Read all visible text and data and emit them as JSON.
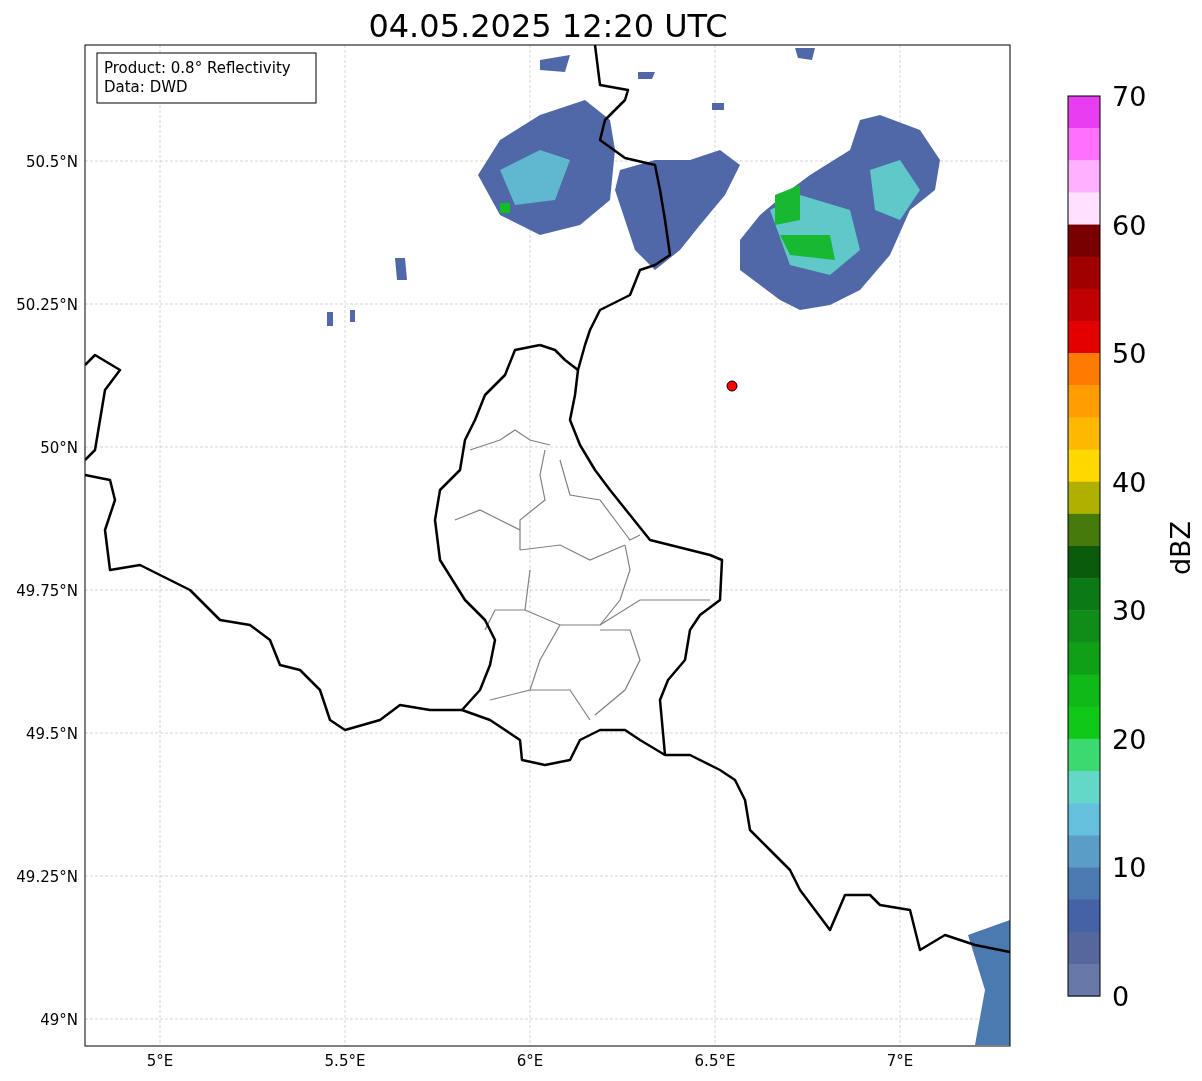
{
  "title": "04.05.2025 12:20 UTC",
  "legend": [
    "Product: 0.8° Reflectivity",
    "Data: DWD"
  ],
  "map": {
    "xticks": [
      "5°E",
      "5.5°E",
      "6°E",
      "6.5°E",
      "7°E"
    ],
    "yticks": [
      "50.5°N",
      "50.25°N",
      "50°N",
      "49.75°N",
      "49.5°N",
      "49.25°N",
      "49°N"
    ]
  },
  "colorbar": {
    "label": "dBZ",
    "ticks": [
      "70",
      "60",
      "50",
      "40",
      "30",
      "20",
      "10",
      "0"
    ],
    "segments": [
      {
        "color": "#e83cf0"
      },
      {
        "color": "#ff70ff"
      },
      {
        "color": "#ffb0ff"
      },
      {
        "color": "#ffe0ff"
      },
      {
        "color": "#780000"
      },
      {
        "color": "#a00000"
      },
      {
        "color": "#c00000"
      },
      {
        "color": "#e40000"
      },
      {
        "color": "#ff7a00"
      },
      {
        "color": "#ff9c00"
      },
      {
        "color": "#ffb800"
      },
      {
        "color": "#ffd800"
      },
      {
        "color": "#b0b000"
      },
      {
        "color": "#467a0c"
      },
      {
        "color": "#0a5c0c"
      },
      {
        "color": "#0c7a14"
      },
      {
        "color": "#108c18"
      },
      {
        "color": "#10a018"
      },
      {
        "color": "#10b818"
      },
      {
        "color": "#10c818"
      },
      {
        "color": "#3cd870"
      },
      {
        "color": "#64d8c8"
      },
      {
        "color": "#64c0dc"
      },
      {
        "color": "#5a9ec6"
      },
      {
        "color": "#4a7ab0"
      },
      {
        "color": "#4562a6"
      },
      {
        "color": "#55689e"
      },
      {
        "color": "#6878a8"
      }
    ]
  }
}
